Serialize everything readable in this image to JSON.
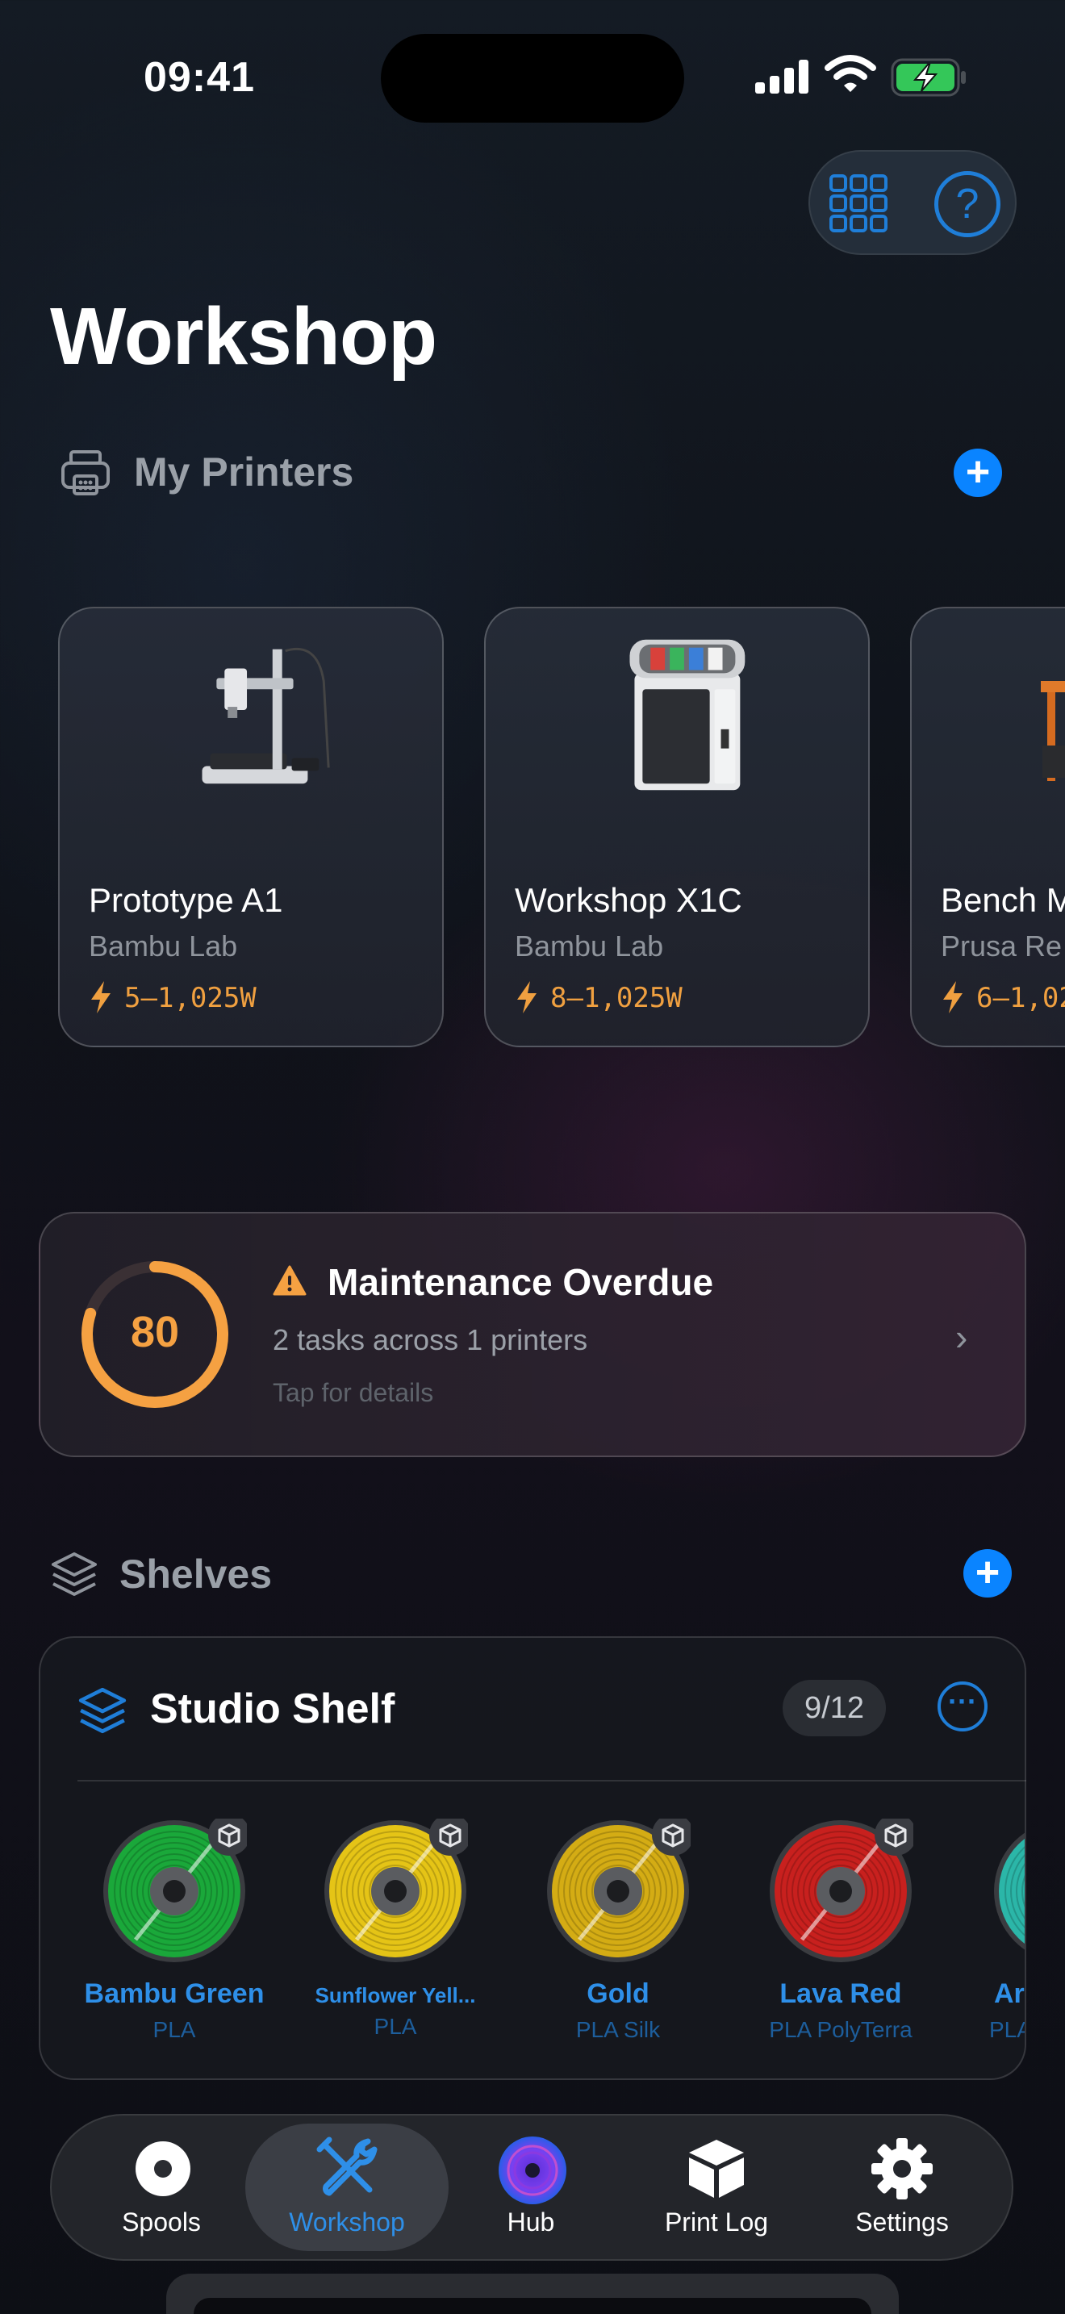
{
  "status_bar": {
    "time": "09:41"
  },
  "header": {
    "title": "Workshop"
  },
  "printers_section": {
    "title": "My Printers",
    "printers": [
      {
        "name": "Prototype A1",
        "brand": "Bambu Lab",
        "power": "5–1,025W"
      },
      {
        "name": "Workshop X1C",
        "brand": "Bambu Lab",
        "power": "8–1,025W"
      },
      {
        "name": "Bench M",
        "brand": "Prusa Re",
        "power": "6–1,02"
      }
    ]
  },
  "maintenance": {
    "score": "80",
    "score_fraction": 0.8,
    "title": "Maintenance Overdue",
    "subtitle": "2 tasks across 1 printers",
    "hint": "Tap for details",
    "accent": "#f5a142"
  },
  "shelves_section": {
    "title": "Shelves",
    "shelf": {
      "name": "Studio Shelf",
      "count": "9/12",
      "spools": [
        {
          "name": "Bambu Green",
          "type": "PLA",
          "color": "#1aa83a"
        },
        {
          "name": "Sunflower Yell...",
          "type": "PLA",
          "color": "#e5c416"
        },
        {
          "name": "Gold",
          "type": "PLA Silk",
          "color": "#d4ac14"
        },
        {
          "name": "Lava Red",
          "type": "PLA PolyTerra",
          "color": "#c8201e"
        },
        {
          "name": "Ar",
          "type": "PLA",
          "color": "#2bb6a8"
        }
      ]
    }
  },
  "tabbar": {
    "active": "Workshop",
    "tabs": [
      {
        "label": "Spools",
        "icon": "spool-icon"
      },
      {
        "label": "Workshop",
        "icon": "tools-icon"
      },
      {
        "label": "Hub",
        "icon": "hub-disc-icon"
      },
      {
        "label": "Print Log",
        "icon": "cube-icon"
      },
      {
        "label": "Settings",
        "icon": "gear-icon"
      }
    ]
  },
  "colors": {
    "accent_blue": "#0a84ff",
    "warning_orange": "#f5a142",
    "link_blue": "#2e8fe8"
  }
}
